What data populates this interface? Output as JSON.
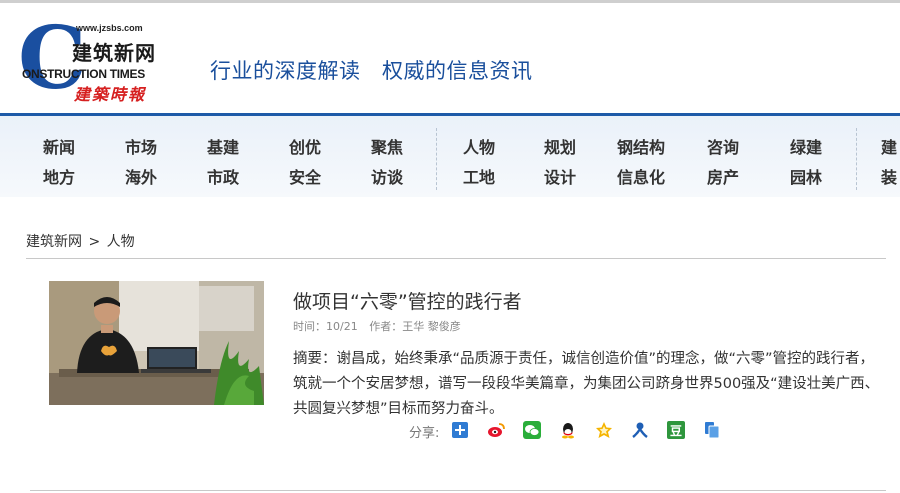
{
  "header": {
    "logo": {
      "letter": "C",
      "url": "www.jzsbs.com",
      "name_cn": "建筑新网",
      "name_en": "ONSTRUCTION TIMES",
      "name_cn_script": "建築時報"
    },
    "slogan": "行业的深度解读   权威的信息资讯"
  },
  "nav": {
    "groups": [
      {
        "row1": [
          "新闻",
          "市场",
          "基建",
          "创优",
          "聚焦"
        ],
        "row2": [
          "地方",
          "海外",
          "市政",
          "安全",
          "访谈"
        ]
      },
      {
        "row1": [
          "人物",
          "规划",
          "钢结构",
          "咨询",
          "绿建"
        ],
        "row2": [
          "工地",
          "设计",
          "信息化",
          "房产",
          "园林"
        ]
      },
      {
        "row1": [
          "建"
        ],
        "row2": [
          "装"
        ]
      }
    ]
  },
  "breadcrumb": {
    "home": "建筑新网",
    "separator": ">",
    "current": "人物"
  },
  "article": {
    "title": "做项目“六零”管控的践行者",
    "time_label": "时间：10/21",
    "author_label": "作者：王华 黎俊彦",
    "summary": "摘要：谢昌成，始终秉承“品质源于责任，诚信创造价值”的理念，做“六零”管控的践行者，筑就一个个安居梦想，谱写一段段华美篇章，为集团公司跻身世界500强及“建设壮美广西、共圆复兴梦想”目标而努力奋斗。",
    "photo_icon": "person-at-desk-photo"
  },
  "share": {
    "label": "分享:",
    "icons": [
      {
        "name": "share-more-icon",
        "color": "#2f7bd3"
      },
      {
        "name": "weibo-icon",
        "color": "#e6162d"
      },
      {
        "name": "wechat-icon",
        "color": "#2aae3a"
      },
      {
        "name": "qq-icon",
        "color": "#1a1a1a"
      },
      {
        "name": "qzone-icon",
        "color": "#f5b400"
      },
      {
        "name": "renren-icon",
        "color": "#1f5fb5"
      },
      {
        "name": "douban-icon",
        "color": "#2e963d"
      },
      {
        "name": "copy-icon",
        "color": "#2f7bd3"
      }
    ]
  }
}
